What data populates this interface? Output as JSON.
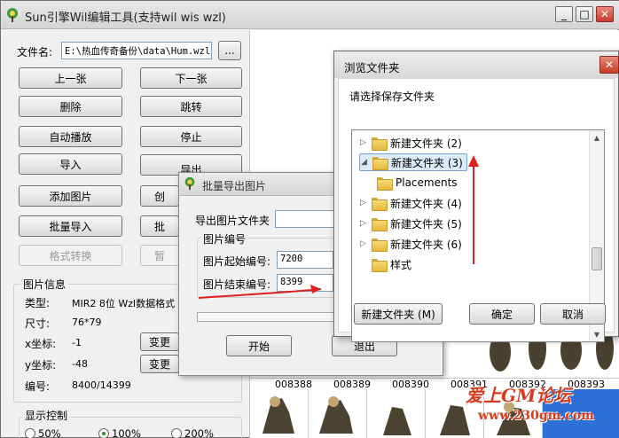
{
  "main_window": {
    "title": "Sun引擎Wil编辑工具(支持wil wis wzl)",
    "controls": {
      "minimize": "_",
      "maximize": "□",
      "close": "✕"
    }
  },
  "left_panel": {
    "filename_label": "文件名:",
    "filename_value": "E:\\热血传奇备份\\data\\Hum.wzl",
    "browse_button": "...",
    "buttons": {
      "prev": "上一张",
      "next": "下一张",
      "delete": "删除",
      "jump": "跳转",
      "autoplay": "自动播放",
      "stop": "停止",
      "import": "导入",
      "export": "导出",
      "add_image": "添加图片",
      "create_partial": "创",
      "batch_import": "批量导入",
      "batch_partial": "批",
      "format_convert": "格式转换",
      "pause_partial": "暂"
    },
    "image_info": {
      "section_title": "图片信息",
      "type_label": "类型:",
      "type_value": "MIR2 8位 Wzl数据格式",
      "size_label": "尺寸:",
      "size_value": "76*79",
      "x_label": "x坐标:",
      "x_value": "-1",
      "x_change": "变更",
      "y_label": "y坐标:",
      "y_value": "-48",
      "y_change": "变更",
      "index_label": "编号:",
      "index_value": "8400/14399"
    },
    "display_control": {
      "section_title": "显示控制",
      "options": [
        "50%",
        "100%",
        "200%"
      ],
      "selected": "100%"
    }
  },
  "thumbnails": {
    "labels": [
      "008388",
      "008389",
      "008390",
      "008391",
      "008392",
      "008393"
    ]
  },
  "batch_export_dialog": {
    "title": "批量导出图片",
    "export_folder_label": "导出图片文件夹",
    "export_folder_value": "",
    "group_title": "图片编号",
    "start_label": "图片起始编号:",
    "start_value": "7200",
    "end_label": "图片结束编号:",
    "end_value": "8399",
    "start_button": "开始",
    "exit_button": "退出"
  },
  "browse_folder_dialog": {
    "title": "浏览文件夹",
    "prompt": "请选择保存文件夹",
    "tree": [
      {
        "label": "新建文件夹 (2)",
        "expander": "▷"
      },
      {
        "label": "新建文件夹 (3)",
        "expander": "◢",
        "selected": true
      },
      {
        "label": "Placements",
        "expander": ""
      },
      {
        "label": "新建文件夹 (4)",
        "expander": "▷"
      },
      {
        "label": "新建文件夹 (5)",
        "expander": "▷"
      },
      {
        "label": "新建文件夹 (6)",
        "expander": "▷"
      },
      {
        "label": "样式",
        "expander": ""
      }
    ],
    "new_folder_button": "新建文件夹 (M)",
    "ok_button": "确定",
    "cancel_button": "取消",
    "close": "✕"
  },
  "watermark": {
    "line1": "爱上GM论坛",
    "line2": "www.230gm.com"
  }
}
